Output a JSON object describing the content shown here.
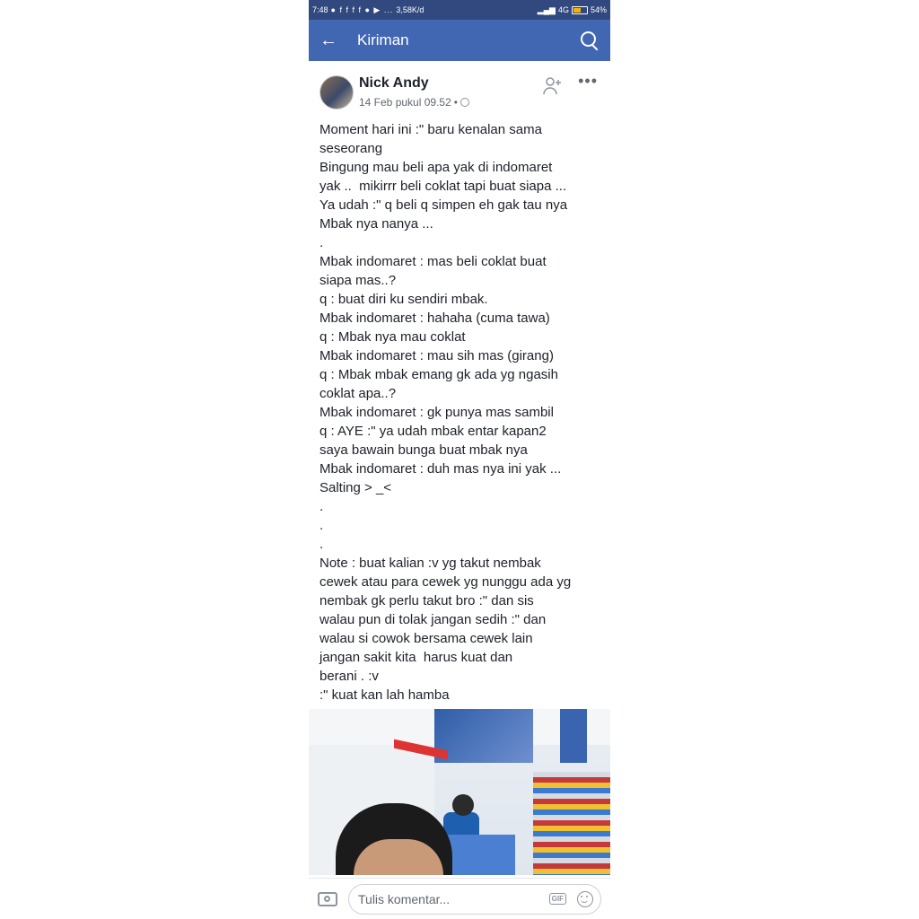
{
  "status_bar": {
    "time": "7:48",
    "net_speed": "3,58K/d",
    "network": "4G",
    "battery": "54%"
  },
  "app_bar": {
    "title": "Kiriman"
  },
  "post": {
    "author": "Nick Andy",
    "timestamp": "14 Feb pukul 09.52",
    "text_lines": [
      "Moment hari ini :\" baru kenalan sama",
      "seseorang",
      "Bingung mau beli apa yak di indomaret",
      "yak ..  mikirrr beli coklat tapi buat siapa ...",
      "Ya udah :\" q beli q simpen eh gak tau nya",
      "Mbak nya nanya ...",
      ".",
      "Mbak indomaret : mas beli coklat buat",
      "siapa mas..?",
      "q : buat diri ku sendiri mbak.",
      "Mbak indomaret : hahaha (cuma tawa)",
      "q : Mbak nya mau coklat",
      "Mbak indomaret : mau sih mas (girang)",
      "q : Mbak mbak emang gk ada yg ngasih",
      "coklat apa..?",
      "Mbak indomaret : gk punya mas sambil",
      "q : AYE :\" ya udah mbak entar kapan2",
      "saya bawain bunga buat mbak nya",
      "Mbak indomaret : duh mas nya ini yak ...",
      "Salting > _<",
      ".",
      ".",
      ".",
      "Note : buat kalian :v yg takut nembak",
      "cewek atau para cewek yg nunggu ada yg",
      "nembak gk perlu takut bro :\" dan sis",
      "walau pun di tolak jangan sedih :\" dan",
      "walau si cowok bersama cewek lain",
      "jangan sakit kita  harus kuat dan",
      "berani . :v",
      ":\" kuat kan lah hamba"
    ]
  },
  "comment_bar": {
    "placeholder": "Tulis komentar...",
    "gif_label": "GIF"
  },
  "colors": {
    "status_bar": "#31497e",
    "app_bar": "#4267b2",
    "text": "#1d2129",
    "meta": "#606770"
  }
}
